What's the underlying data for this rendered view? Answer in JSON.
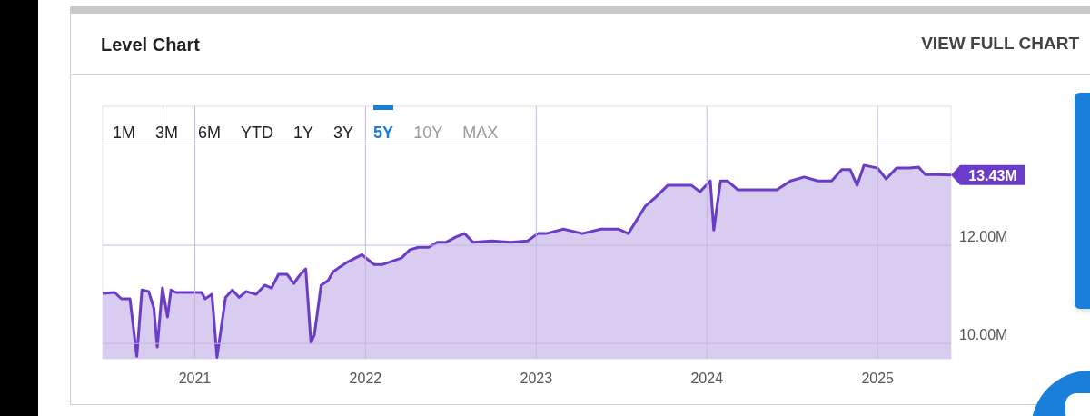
{
  "card": {
    "title": "Level Chart",
    "link": "VIEW FULL CHART"
  },
  "ranges": [
    {
      "label": "1M",
      "selected": false,
      "disabled": false
    },
    {
      "label": "3M",
      "selected": false,
      "disabled": false
    },
    {
      "label": "6M",
      "selected": false,
      "disabled": false
    },
    {
      "label": "YTD",
      "selected": false,
      "disabled": false
    },
    {
      "label": "1Y",
      "selected": false,
      "disabled": false
    },
    {
      "label": "3Y",
      "selected": false,
      "disabled": false
    },
    {
      "label": "5Y",
      "selected": true,
      "disabled": false
    },
    {
      "label": "10Y",
      "selected": false,
      "disabled": true
    },
    {
      "label": "MAX",
      "selected": false,
      "disabled": true
    }
  ],
  "chart_data": {
    "type": "area",
    "grid": true,
    "xlim": [
      2020.46,
      2025.43
    ],
    "ylim": [
      9.69,
      14.83
    ],
    "xticks": [
      {
        "value": 2021,
        "label": "2021"
      },
      {
        "value": 2022,
        "label": "2022"
      },
      {
        "value": 2023,
        "label": "2023"
      },
      {
        "value": 2024,
        "label": "2024"
      },
      {
        "value": 2025,
        "label": "2025"
      }
    ],
    "yticks": [
      {
        "value": 10,
        "label": "10.00M"
      },
      {
        "value": 12,
        "label": "12.00M"
      }
    ],
    "x": [
      2020.46,
      2020.53,
      2020.57,
      2020.62,
      2020.66,
      2020.69,
      2020.73,
      2020.76,
      2020.78,
      2020.81,
      2020.84,
      2020.86,
      2020.89,
      2020.93,
      2021.04,
      2021.06,
      2021.1,
      2021.13,
      2021.18,
      2021.22,
      2021.26,
      2021.3,
      2021.36,
      2021.41,
      2021.45,
      2021.49,
      2021.54,
      2021.58,
      2021.61,
      2021.65,
      2021.68,
      2021.7,
      2021.74,
      2021.78,
      2021.81,
      2021.85,
      2021.89,
      2021.94,
      2021.98,
      2022.02,
      2022.05,
      2022.1,
      2022.21,
      2022.26,
      2022.31,
      2022.37,
      2022.42,
      2022.47,
      2022.53,
      2022.58,
      2022.63,
      2022.74,
      2022.85,
      2022.95,
      2023.01,
      2023.06,
      2023.16,
      2023.27,
      2023.38,
      2023.48,
      2023.54,
      2023.59,
      2023.64,
      2023.7,
      2023.77,
      2023.91,
      2023.96,
      2024.02,
      2024.04,
      2024.08,
      2024.12,
      2024.18,
      2024.41,
      2024.49,
      2024.57,
      2024.65,
      2024.73,
      2024.79,
      2024.84,
      2024.88,
      2024.92,
      2025.0,
      2025.05,
      2025.11,
      2025.19,
      2025.24,
      2025.28,
      2025.35,
      2025.43
    ],
    "series": [
      {
        "color": "#6a3cc8",
        "values": [
          11.02,
          11.04,
          10.91,
          10.91,
          9.74,
          11.09,
          11.06,
          10.72,
          9.93,
          11.13,
          10.54,
          11.09,
          11.04,
          11.04,
          11.04,
          10.91,
          11.0,
          9.72,
          10.94,
          11.09,
          10.94,
          11.06,
          11.0,
          11.19,
          11.13,
          11.41,
          11.41,
          11.22,
          11.37,
          11.52,
          10.02,
          10.17,
          11.19,
          11.28,
          11.46,
          11.56,
          11.65,
          11.74,
          11.81,
          11.69,
          11.61,
          11.61,
          11.74,
          11.91,
          11.96,
          11.96,
          12.06,
          12.06,
          12.17,
          12.24,
          12.06,
          12.09,
          12.06,
          12.09,
          12.24,
          12.24,
          12.33,
          12.24,
          12.33,
          12.33,
          12.24,
          12.52,
          12.8,
          12.98,
          13.22,
          13.22,
          13.09,
          13.31,
          12.31,
          13.31,
          13.31,
          13.13,
          13.13,
          13.31,
          13.39,
          13.31,
          13.31,
          13.54,
          13.54,
          13.22,
          13.63,
          13.57,
          13.35,
          13.57,
          13.57,
          13.59,
          13.44,
          13.44,
          13.43
        ]
      }
    ],
    "annotations": [
      {
        "x": 2025.43,
        "y": 13.43,
        "text": "13.43M"
      }
    ]
  }
}
